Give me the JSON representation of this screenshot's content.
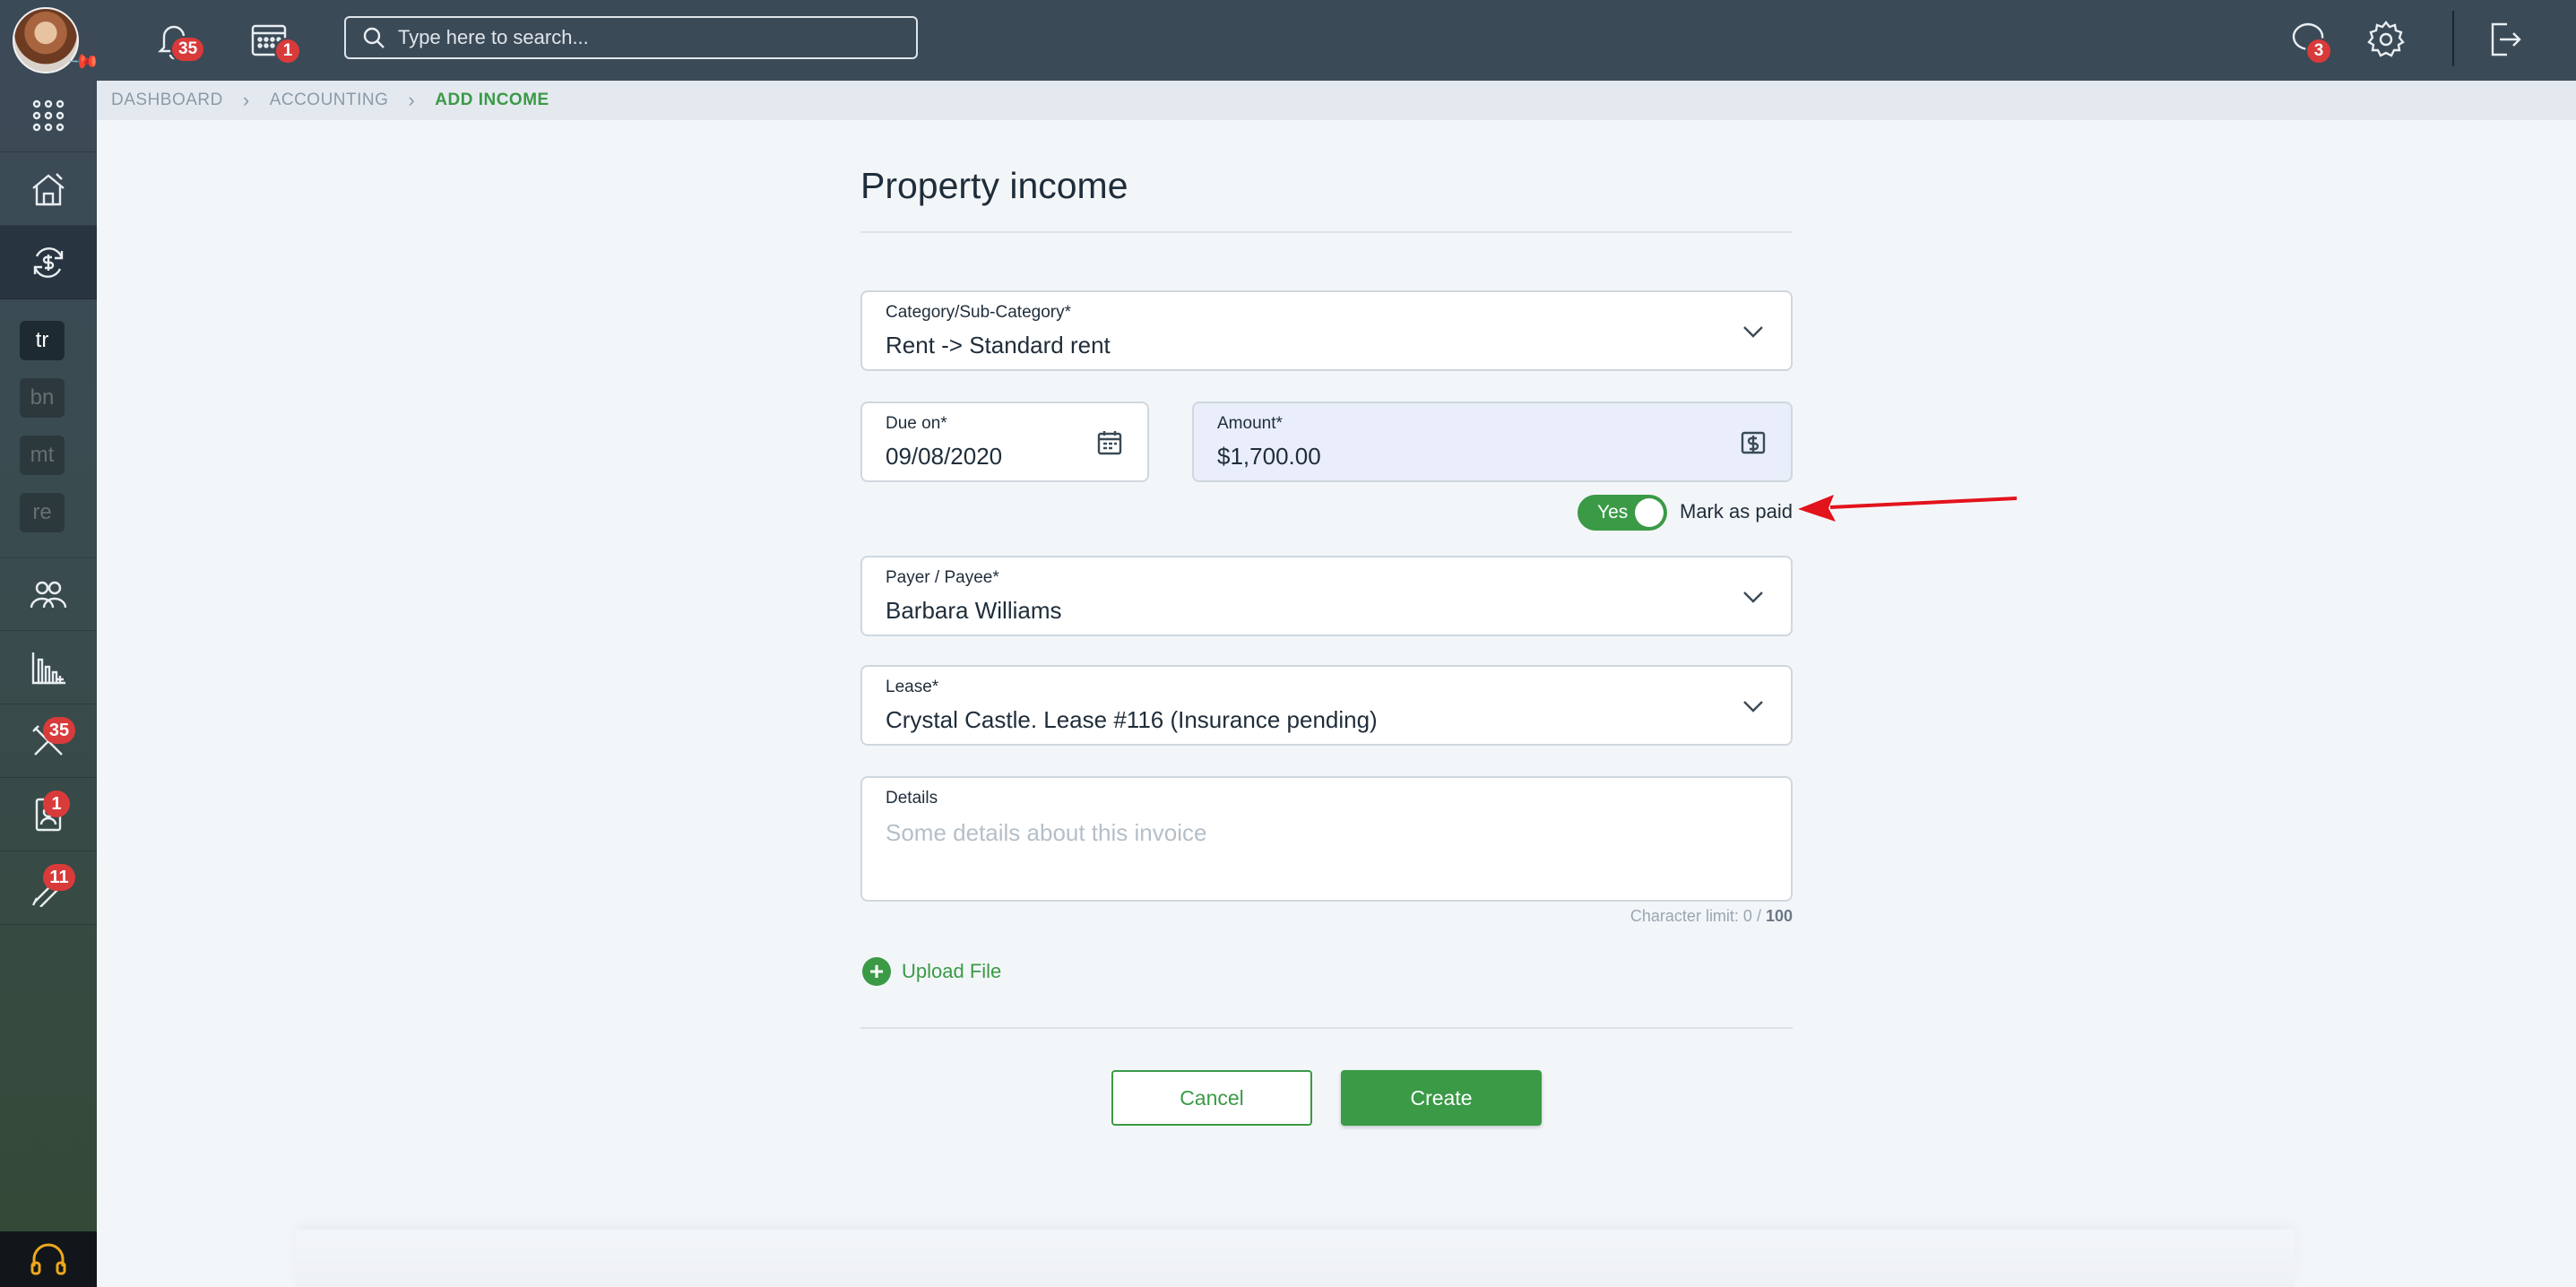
{
  "topbar": {
    "notifications_count": "35",
    "calendar_count": "1",
    "search_placeholder": "Type here to search...",
    "messages_count": "3"
  },
  "sidebar": {
    "properties": [
      "tr",
      "bn",
      "mt",
      "re"
    ],
    "maintenance_count": "35",
    "applications_count": "1",
    "tools_count": "11"
  },
  "breadcrumb": [
    "DASHBOARD",
    "ACCOUNTING",
    "ADD INCOME"
  ],
  "form": {
    "title": "Property income",
    "category": {
      "label": "Category/Sub-Category*",
      "value": "Rent -> Standard rent"
    },
    "due_on": {
      "label": "Due on*",
      "value": "09/08/2020"
    },
    "amount": {
      "label": "Amount*",
      "value": "$1,700.00"
    },
    "paid_toggle": {
      "state_label": "Yes",
      "label": "Mark as paid"
    },
    "payer": {
      "label": "Payer / Payee*",
      "value": "Barbara Williams"
    },
    "lease": {
      "label": "Lease*",
      "value": "Crystal Castle. Lease #116 (Insurance pending)"
    },
    "details": {
      "label": "Details",
      "placeholder": "Some details about this invoice"
    },
    "char_limit": {
      "prefix": "Character limit: 0 / ",
      "max": "100"
    },
    "upload_label": "Upload File",
    "cancel_label": "Cancel",
    "create_label": "Create"
  },
  "colors": {
    "accent_green": "#3a9a46",
    "topbar": "#3b4a57",
    "badge_red": "#d93a3a",
    "annotation_red": "#e3131b"
  }
}
